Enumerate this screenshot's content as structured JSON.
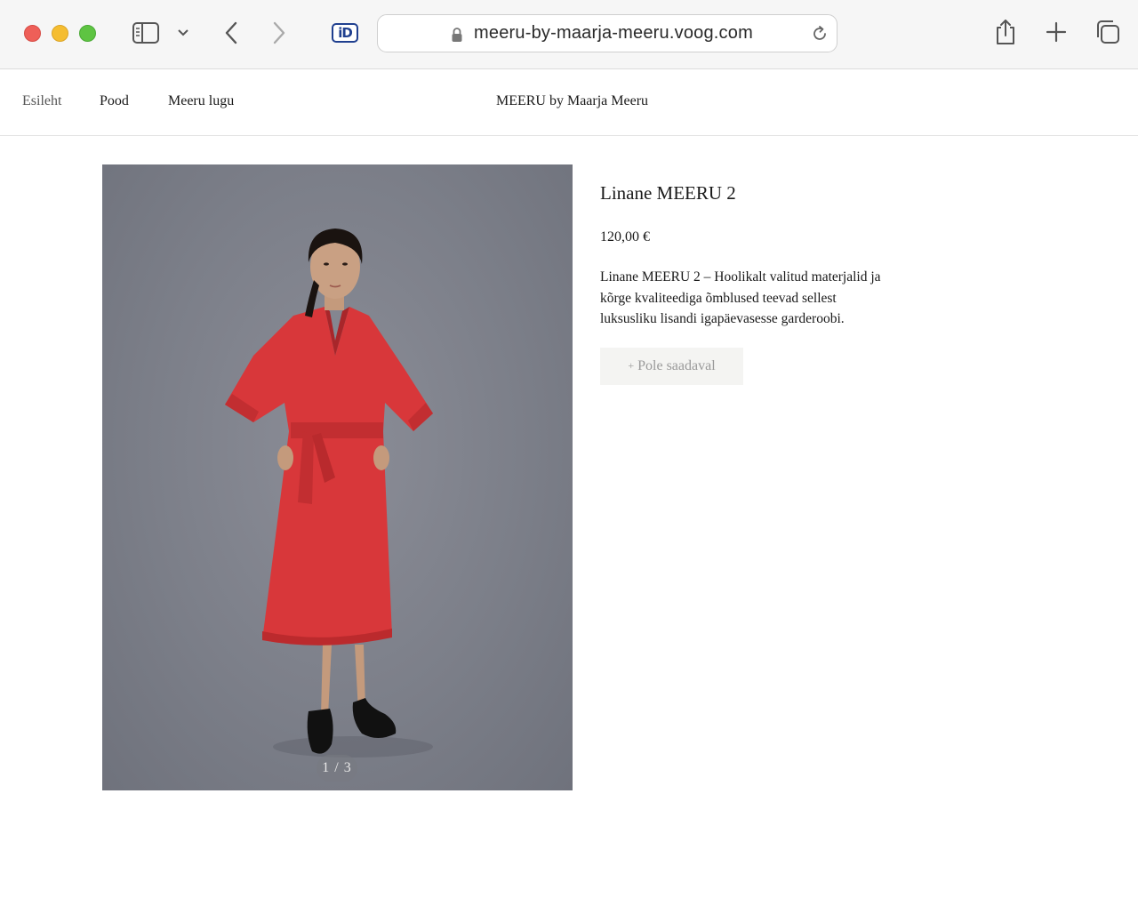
{
  "browser": {
    "url": "meeru-by-maarja-meeru.voog.com",
    "extension_label": "iD",
    "icons": {
      "close": "traffic-close",
      "minimize": "traffic-minimize",
      "maximize": "traffic-maximize",
      "sidebar": "sidebar-icon",
      "chevron": "chevron-down-icon",
      "back": "chevron-left-icon",
      "forward": "chevron-right-icon",
      "lock": "lock-icon",
      "reload": "reload-icon",
      "share": "share-icon",
      "new_tab": "plus-icon",
      "tabs": "tabs-overview-icon"
    }
  },
  "header": {
    "nav": [
      {
        "label": "Esileht"
      },
      {
        "label": "Pood"
      },
      {
        "label": "Meeru lugu"
      }
    ],
    "site_title": "MEERU by Maarja Meeru"
  },
  "product": {
    "title": "Linane MEERU 2",
    "price": "120,00 €",
    "description": "Linane MEERU 2 – Hoolikalt valitud materjalid ja kõrge kvaliteediga õmblused teevad sellest luksusliku lisandi igapäevasesse garderoobi.",
    "button_plus": "+",
    "button_label": "Pole saadaval",
    "gallery_counter": "1 / 3"
  },
  "colors": {
    "dress": "#d8373a",
    "backdrop": "#7c7f89",
    "button_bg": "#f4f4f2"
  }
}
